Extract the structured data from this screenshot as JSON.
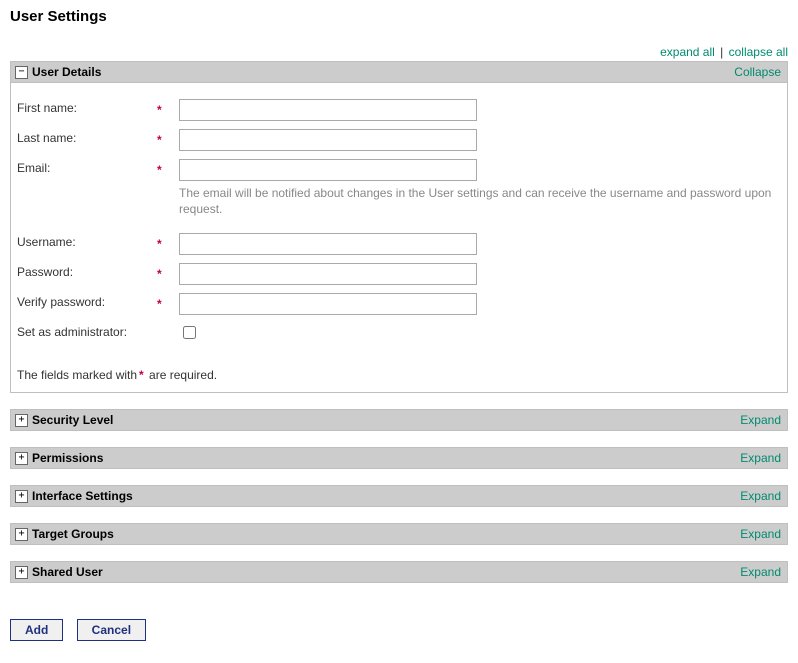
{
  "page_title": "User Settings",
  "links": {
    "expand_all": "expand all",
    "collapse_all": "collapse all",
    "collapse": "Collapse",
    "expand": "Expand"
  },
  "sections": {
    "user_details": {
      "title": "User Details"
    },
    "security_level": {
      "title": "Security Level"
    },
    "permissions": {
      "title": "Permissions"
    },
    "interface_settings": {
      "title": "Interface Settings"
    },
    "target_groups": {
      "title": "Target Groups"
    },
    "shared_user": {
      "title": "Shared User"
    }
  },
  "fields": {
    "first_name": {
      "label": "First name:",
      "value": ""
    },
    "last_name": {
      "label": "Last name:",
      "value": ""
    },
    "email": {
      "label": "Email:",
      "value": "",
      "hint": "The email will be notified about changes in the User settings and can receive the username and password upon request."
    },
    "username": {
      "label": "Username:",
      "value": ""
    },
    "password": {
      "label": "Password:",
      "value": ""
    },
    "verify_password": {
      "label": "Verify password:",
      "value": ""
    },
    "set_as_admin": {
      "label": "Set as administrator:"
    }
  },
  "required_note_prefix": "The fields marked with",
  "required_note_suffix": " are required.",
  "buttons": {
    "add": "Add",
    "cancel": "Cancel"
  }
}
